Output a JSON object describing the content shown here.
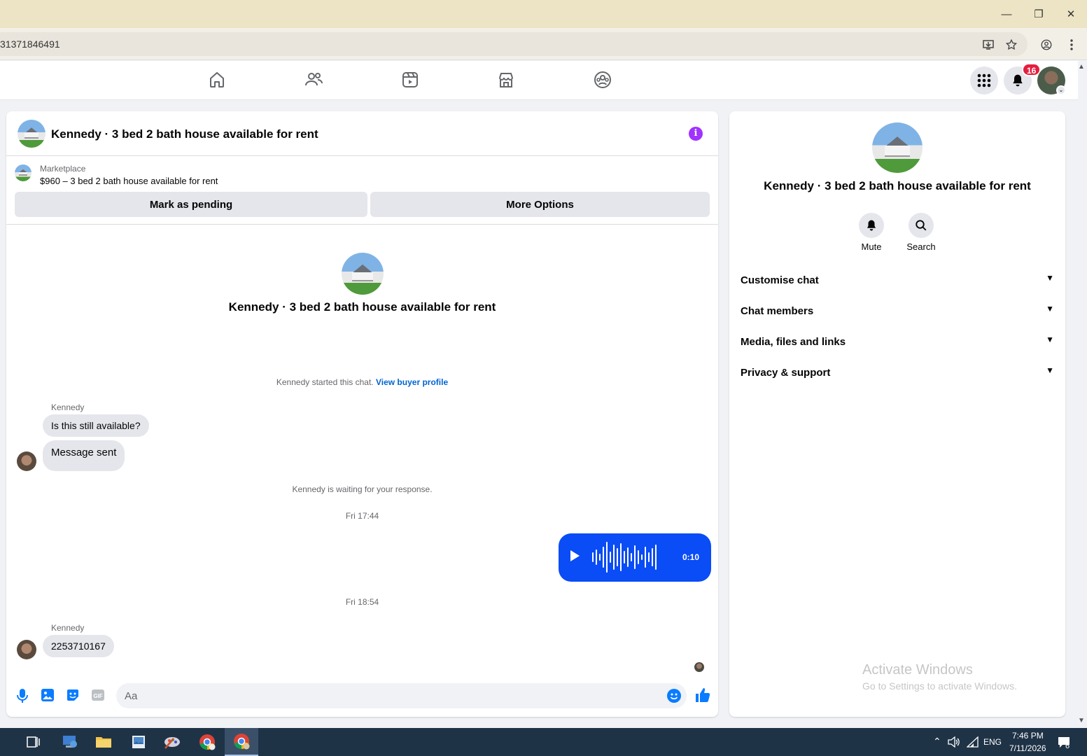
{
  "browser": {
    "url": "31371846491",
    "window_controls": {
      "minimize": "—",
      "restore": "❐",
      "close": "✕"
    }
  },
  "nav": {
    "icons": [
      "home-icon",
      "friends-icon",
      "watch-icon",
      "marketplace-icon",
      "groups-icon"
    ],
    "notifications_count": "16"
  },
  "chat": {
    "title": "Kennedy · 3 bed 2 bath house available for rent",
    "listing": {
      "category": "Marketplace",
      "price_line": "$960 – 3 bed 2 bath house available for rent",
      "mark_pending": "Mark as pending",
      "more_options": "More Options"
    },
    "center_name": "Kennedy · 3 bed 2 bath house available for rent",
    "started_text": "Kennedy started this chat.",
    "view_profile": "View buyer profile",
    "messages": [
      {
        "sender": "Kennedy",
        "text": "Is this still available?"
      },
      {
        "text": "Message sent"
      }
    ],
    "waiting_text": "Kennedy is waiting for your response.",
    "time1": "Fri 17:44",
    "voice_duration": "0:10",
    "time2": "Fri 18:54",
    "last_sender": "Kennedy",
    "last_message": "2253710167",
    "composer_placeholder": "Aa",
    "accent_color": "#0a4cf5"
  },
  "info_panel": {
    "name": "Kennedy · 3 bed 2 bath house available for rent",
    "mute_label": "Mute",
    "search_label": "Search",
    "sections": [
      "Customise chat",
      "Chat members",
      "Media, files and links",
      "Privacy & support"
    ],
    "watermark_title": "Activate Windows",
    "watermark_sub": "Go to Settings to activate Windows."
  },
  "taskbar": {
    "lang": "ENG",
    "time": "7:46 PM",
    "date": "7/11/2026",
    "notif_count": "6"
  }
}
